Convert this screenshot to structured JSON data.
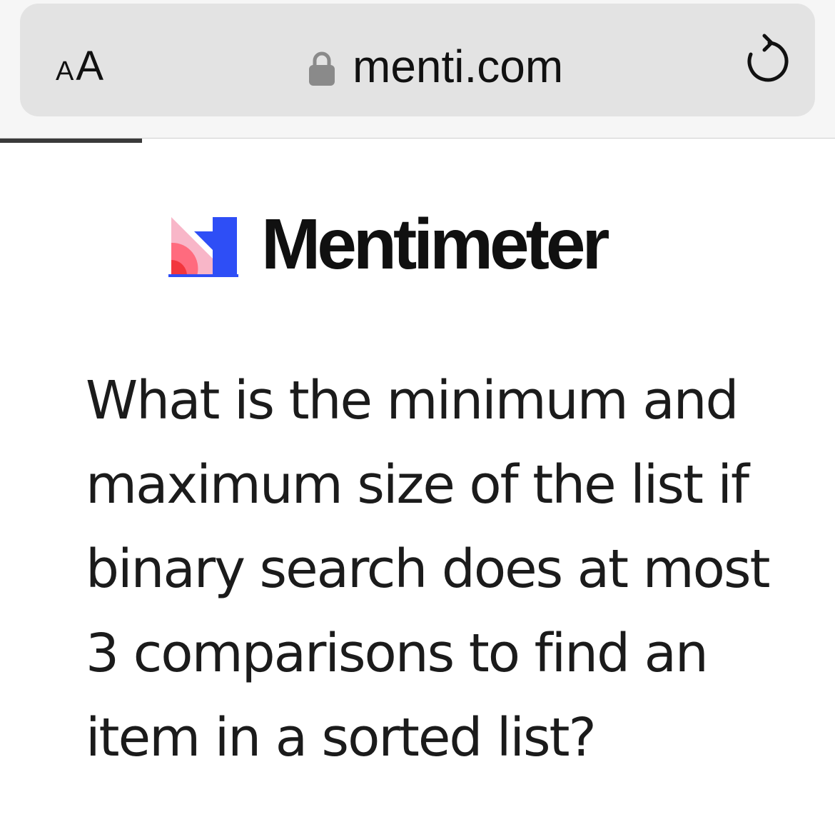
{
  "browser": {
    "text_size_small": "A",
    "text_size_large": "A",
    "url": "menti.com",
    "page_load_progress": 0.17
  },
  "logo": {
    "name": "Mentimeter",
    "colors": {
      "pink": "#f8b6c8",
      "coral": "#ff6b7e",
      "red": "#f2363d",
      "blue": "#2e4ef6"
    }
  },
  "question": {
    "text": "What is the minimum and maximum size of the list if binary search does at most 3 comparisons to find an item in a sorted list?"
  },
  "icons": {
    "lock": "lock-icon",
    "reload": "reload-icon"
  }
}
